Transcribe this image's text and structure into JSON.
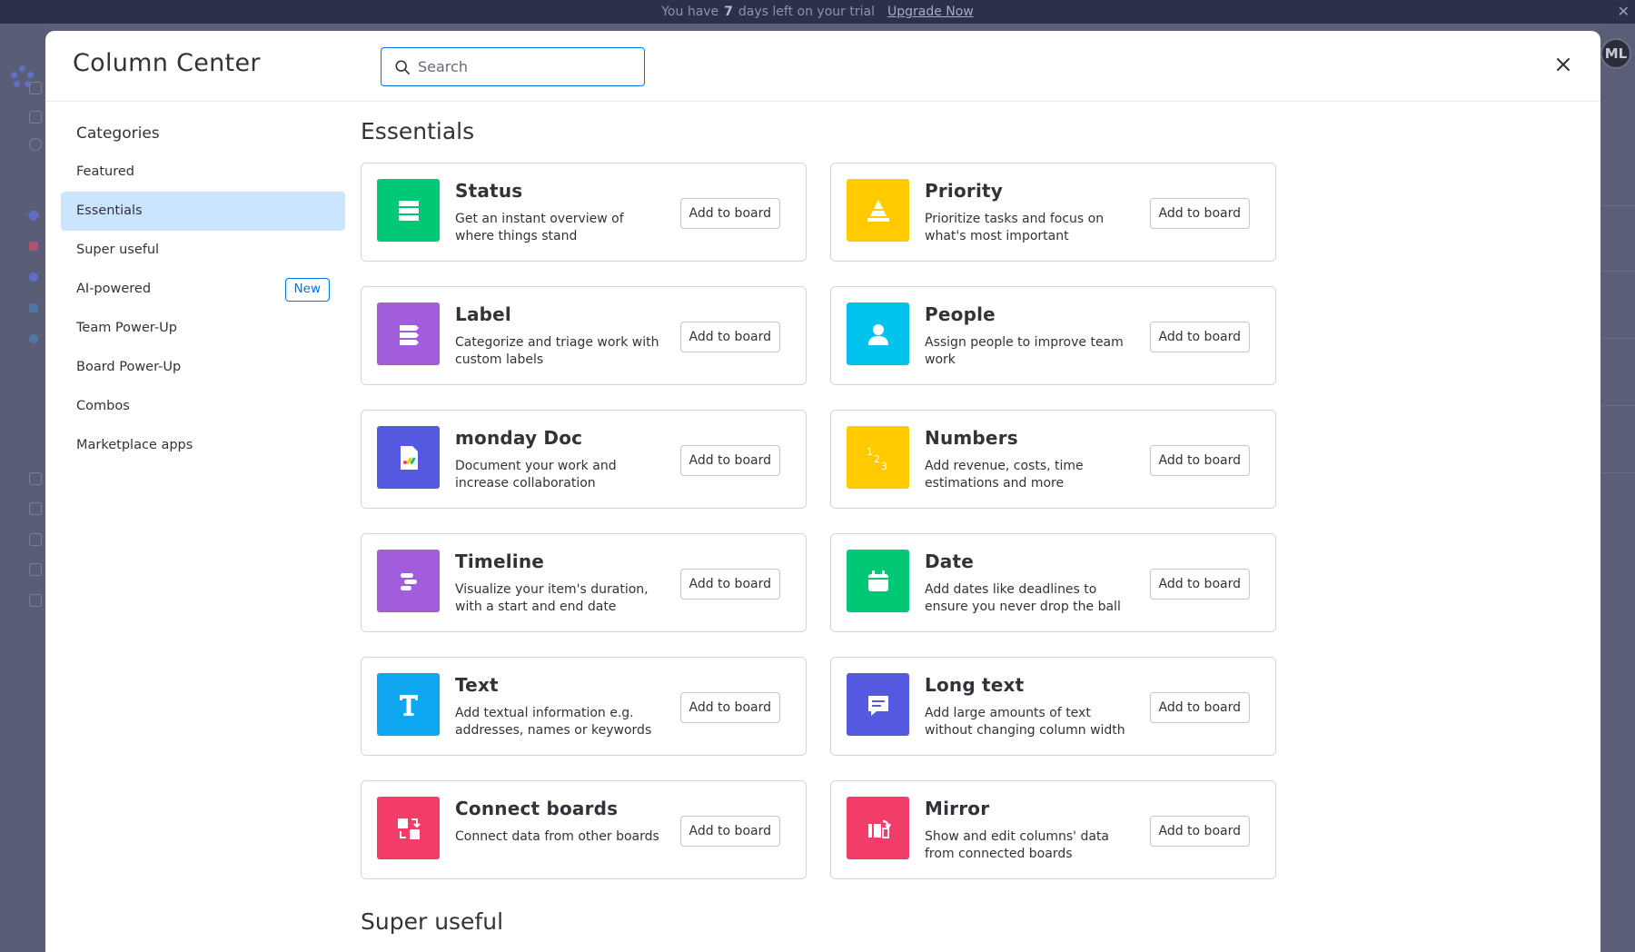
{
  "banner": {
    "text_before": "You have",
    "days": "7",
    "text_after": "days left on your trial",
    "upgrade_label": "Upgrade Now",
    "close_icon": "close-icon"
  },
  "background_app": {
    "avatar_initials": "ML"
  },
  "modal": {
    "title": "Column Center",
    "search_placeholder": "Search",
    "search_value": ""
  },
  "sidebar": {
    "heading": "Categories",
    "items": [
      {
        "label": "Featured",
        "active": false
      },
      {
        "label": "Essentials",
        "active": true
      },
      {
        "label": "Super useful",
        "active": false
      },
      {
        "label": "AI-powered",
        "active": false,
        "badge": "New"
      },
      {
        "label": "Team Power-Up",
        "active": false
      },
      {
        "label": "Board Power-Up",
        "active": false
      },
      {
        "label": "Combos",
        "active": false
      },
      {
        "label": "Marketplace apps",
        "active": false
      }
    ]
  },
  "sections": {
    "essentials_title": "Essentials",
    "super_useful_title": "Super useful"
  },
  "add_label": "Add to board",
  "cards": [
    {
      "title": "Status",
      "desc": "Get an instant overview of where things stand",
      "color": "#00c875",
      "icon": "status-icon"
    },
    {
      "title": "Priority",
      "desc": "Prioritize tasks and focus on what's most important",
      "color": "#ffcb00",
      "icon": "priority-icon"
    },
    {
      "title": "Label",
      "desc": "Categorize and triage work with custom labels",
      "color": "#a25ddc",
      "icon": "label-icon"
    },
    {
      "title": "People",
      "desc": "Assign people to improve team work",
      "color": "#00c2ed",
      "icon": "people-icon"
    },
    {
      "title": "monday Doc",
      "desc": "Document your work and increase collaboration",
      "color": "#5559df",
      "icon": "doc-icon"
    },
    {
      "title": "Numbers",
      "desc": "Add revenue, costs, time estimations and more",
      "color": "#ffcb00",
      "icon": "numbers-icon"
    },
    {
      "title": "Timeline",
      "desc": "Visualize your item's duration, with a start and end date",
      "color": "#a25ddc",
      "icon": "timeline-icon"
    },
    {
      "title": "Date",
      "desc": "Add dates like deadlines to ensure you never drop the ball",
      "color": "#00c875",
      "icon": "calendar-icon"
    },
    {
      "title": "Text",
      "desc": "Add textual information e.g. addresses, names or keywords",
      "color": "#0fa6f2",
      "icon": "text-icon"
    },
    {
      "title": "Long text",
      "desc": "Add large amounts of text without changing column width",
      "color": "#5559df",
      "icon": "long-text-icon"
    },
    {
      "title": "Connect boards",
      "desc": "Connect data from other boards",
      "color": "#f23d68",
      "icon": "connect-boards-icon"
    },
    {
      "title": "Mirror",
      "desc": "Show and edit columns' data from connected boards",
      "color": "#f23d68",
      "icon": "mirror-icon"
    }
  ]
}
